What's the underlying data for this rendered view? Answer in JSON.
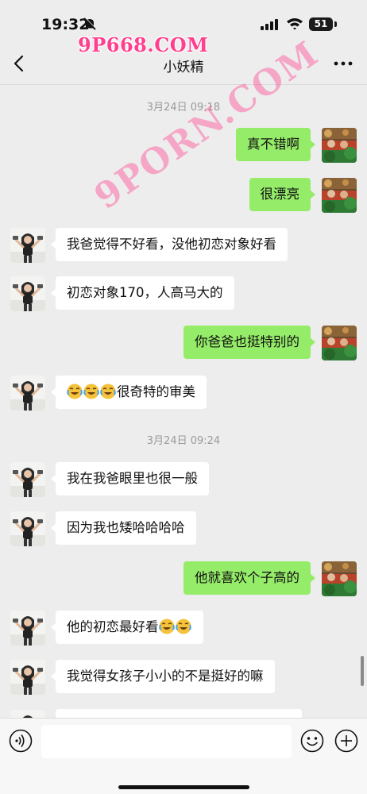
{
  "status_bar": {
    "time": "19:32",
    "battery": "51"
  },
  "watermark": {
    "top": "9P668.COM",
    "diagonal": "9PORN.COM"
  },
  "header": {
    "title": "小妖精"
  },
  "timestamps": [
    "3月24日 09:18",
    "3月24日 09:24"
  ],
  "messages": [
    {
      "side": "right",
      "text": "真不错啊"
    },
    {
      "side": "right",
      "text": "很漂亮"
    },
    {
      "side": "left",
      "text": "我爸觉得不好看，没他初恋对象好看"
    },
    {
      "side": "left",
      "text": "初恋对象170，人高马大的"
    },
    {
      "side": "right",
      "text": "你爸爸也挺特别的"
    },
    {
      "side": "left",
      "text": "很奇特的审美",
      "leading_emoji": 3
    },
    {
      "side": "left",
      "text": "我在我爸眼里也很一般"
    },
    {
      "side": "left",
      "text": "因为我也矮哈哈哈哈"
    },
    {
      "side": "right",
      "text": "他就喜欢个子高的"
    },
    {
      "side": "left",
      "text": "他的初恋最好看",
      "trailing_emoji": 2
    },
    {
      "side": "left",
      "text": "我觉得女孩子小小的不是挺好的嘛"
    }
  ],
  "icons": [
    "bell-slash-icon",
    "signal-icon",
    "wifi-icon",
    "back-icon",
    "more-icon",
    "voice-icon",
    "emoji-icon",
    "plus-icon"
  ],
  "colors": {
    "bubble_self": "#95ec69",
    "bubble_other": "#ffffff",
    "background": "#ededed",
    "watermark": "#ff3f8f"
  }
}
